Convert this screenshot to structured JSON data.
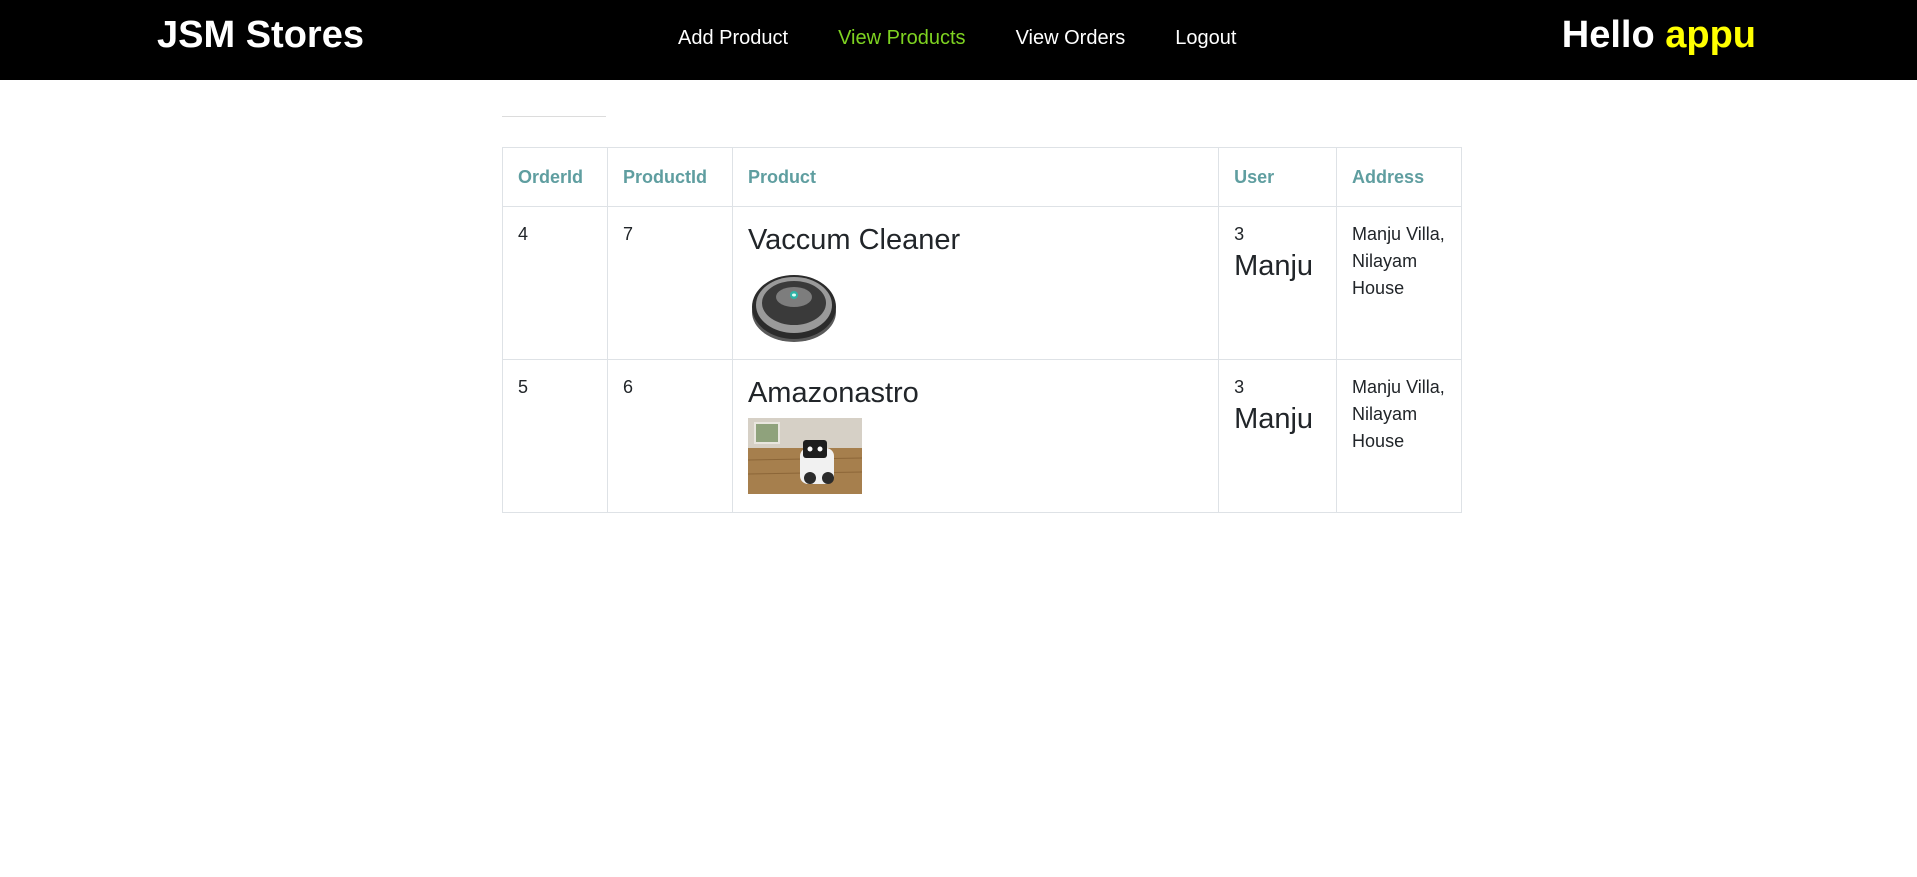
{
  "header": {
    "brand": "JSM Stores",
    "nav": [
      {
        "label": "Add Product",
        "active": false
      },
      {
        "label": "View Products",
        "active": true
      },
      {
        "label": "View Orders",
        "active": false
      },
      {
        "label": "Logout",
        "active": false
      }
    ],
    "greeting_prefix": "Hello",
    "username": "appu"
  },
  "colors": {
    "navbar_bg": "#000000",
    "active_link": "#7ed321",
    "username": "#ffff00",
    "table_header_text": "#5f9ea0"
  },
  "table": {
    "columns": [
      "OrderId",
      "ProductId",
      "Product",
      "User",
      "Address"
    ],
    "rows": [
      {
        "order_id": "4",
        "product_id": "7",
        "product_name": "Vaccum Cleaner",
        "product_image": "robot-vacuum-image",
        "user_id": "3",
        "user_name": "Manju",
        "address": "Manju Villa, Nilayam House"
      },
      {
        "order_id": "5",
        "product_id": "6",
        "product_name": "Amazonastro",
        "product_image": "amazon-astro-robot-image",
        "user_id": "3",
        "user_name": "Manju",
        "address": "Manju Villa, Nilayam House"
      }
    ]
  }
}
